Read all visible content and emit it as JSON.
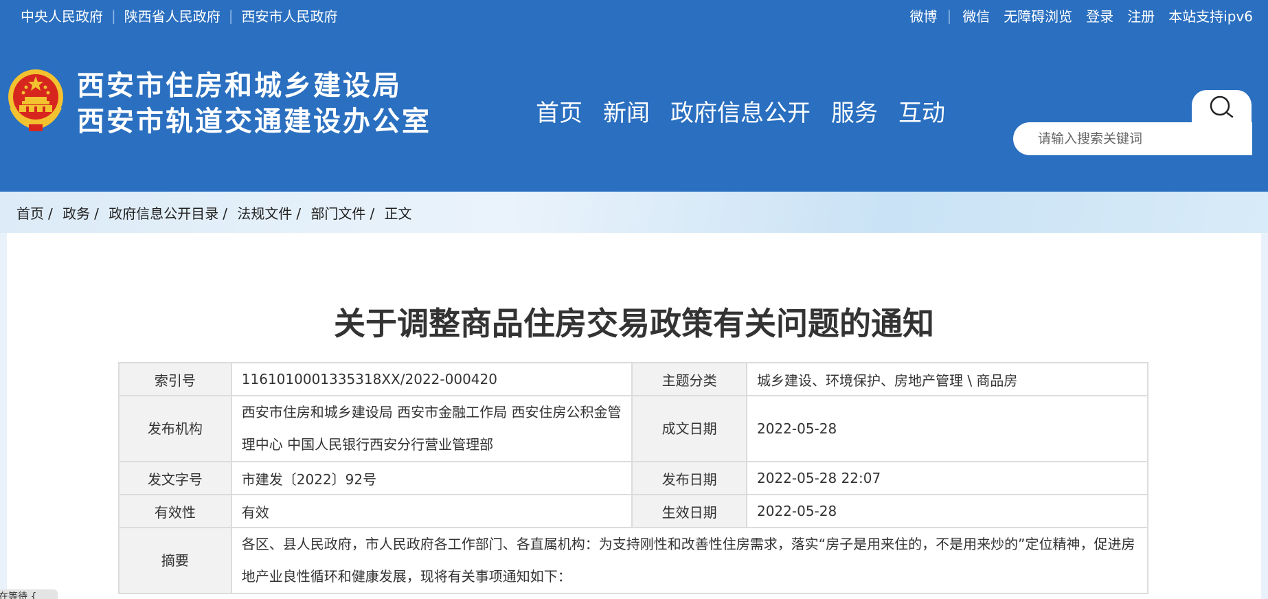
{
  "topbar": {
    "left_links": [
      "中央人民政府",
      "陕西省人民政府",
      "西安市人民政府"
    ],
    "separator": "|",
    "right_links": [
      "微博",
      "微信",
      "无障碍浏览",
      "登录",
      "注册",
      "本站支持ipv6"
    ]
  },
  "header": {
    "title_line1": "西安市住房和城乡建设局",
    "title_line2": "西安市轨道交通建设办公室",
    "nav": [
      "首页",
      "新闻",
      "政府信息公开",
      "服务",
      "互动"
    ],
    "search_placeholder": "请输入搜索关键词"
  },
  "breadcrumb": [
    "首页",
    "政务",
    "政府信息公开目录",
    "法规文件",
    "部门文件",
    "正文"
  ],
  "breadcrumb_sep": "/",
  "document": {
    "title": "关于调整商品住房交易政策有关问题的通知",
    "meta": {
      "index_label": "索引号",
      "index_value": "1161010001335318XX/2022-000420",
      "topic_label": "主题分类",
      "topic_value": "城乡建设、环境保护、房地产管理 \\ 商品房",
      "issuer_label": "发布机构",
      "issuer_value": "西安市住房和城乡建设局 西安市金融工作局 西安住房公积金管理中心 中国人民银行西安分行营业管理部",
      "written_date_label": "成文日期",
      "written_date_value": "2022-05-28",
      "doc_number_label": "发文字号",
      "doc_number_value": "市建发〔2022〕92号",
      "publish_date_label": "发布日期",
      "publish_date_value": "2022-05-28 22:07",
      "validity_label": "有效性",
      "validity_value": "有效",
      "effective_date_label": "生效日期",
      "effective_date_value": "2022-05-28",
      "summary_label": "摘要",
      "summary_value": "各区、县人民政府，市人民政府各工作部门、各直属机构：为支持刚性和改善性住房需求，落实“房子是用来住的，不是用来炒的”定位精神，促进房地产业良性循环和健康发展，现将有关事项通知如下："
    }
  },
  "tooltip_text": "在等待 {",
  "colors": {
    "header_blue": "#2a6fc0",
    "emblem_red": "#d7261e",
    "emblem_gold": "#f2c230"
  }
}
